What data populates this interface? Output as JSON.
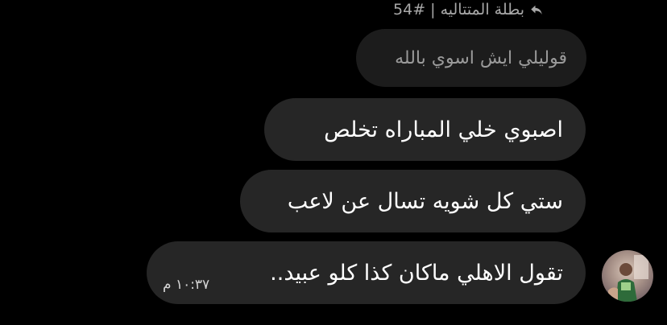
{
  "reply": {
    "icon": "reply-arrow-icon",
    "text": "بطلة المتتاليه | #54"
  },
  "quoted_message": {
    "text": "قوليلي ايش اسوي بالله"
  },
  "messages": [
    {
      "text": "اصبوي خلي المباراه تخلص"
    },
    {
      "text": "ستي كل شويه تسال عن لاعب"
    },
    {
      "text": "تقول الاهلي ماكان كذا كلو عبيد..",
      "time": "١٠:٣٧ م"
    }
  ],
  "sender": {
    "avatar_icon": "profile-avatar"
  },
  "colors": {
    "background": "#000000",
    "bubble": "#262626",
    "quoted_bubble": "#1c1c1c",
    "muted_text": "#a8a8a8"
  }
}
